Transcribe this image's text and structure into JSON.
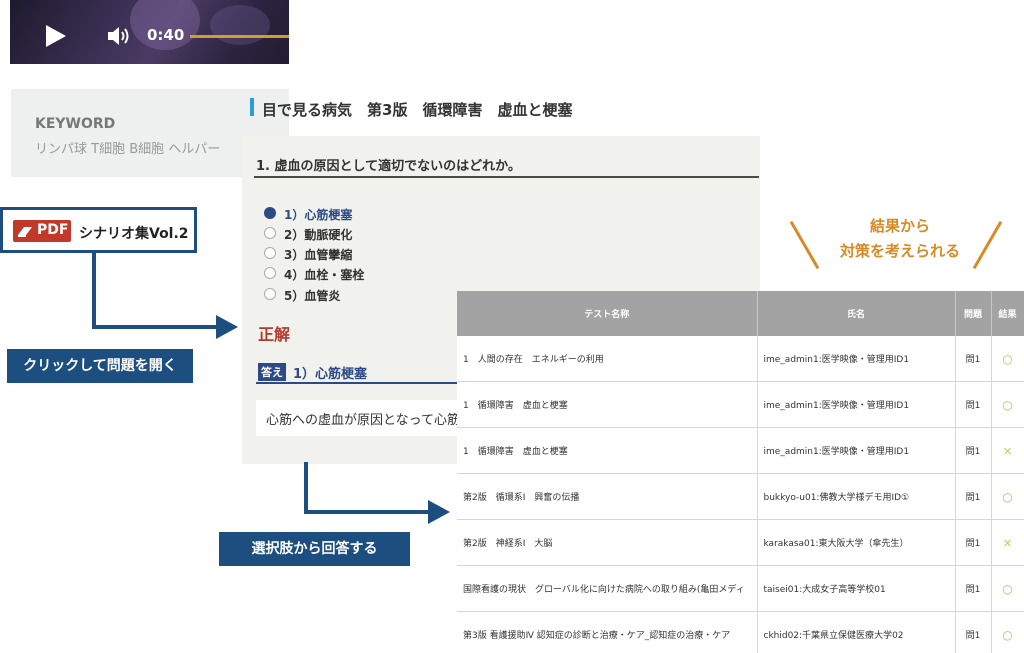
{
  "video": {
    "time": "0:40",
    "progress": 0.4
  },
  "keyword": {
    "label": "KEYWORD",
    "text": "リンパ球 T細胞 B細胞 ヘルパー"
  },
  "pdf_button": {
    "badge": "PDF",
    "title": "シナリオ集Vol.2"
  },
  "callouts": {
    "open_question": "クリックして問題を開く",
    "answer_choice": "選択肢から回答する"
  },
  "quiz": {
    "header": "目で見る病気　第3版　循環障害　虚血と梗塞",
    "question": "1. 虚血の原因として適切でないのはどれか。",
    "options": [
      "1）心筋梗塞",
      "2）動脈硬化",
      "3）血管攣縮",
      "4）血栓・塞栓",
      "5）血管炎"
    ],
    "selected_index": 0,
    "result_label": "正解",
    "answer_tag": "答え",
    "answer_text": "1）心筋梗塞",
    "explanation": "心筋への虚血が原因となって心筋"
  },
  "results_note": {
    "line1": "結果から",
    "line2": "対策を考えられる"
  },
  "results_table": {
    "headers": {
      "test_name": "テスト名称",
      "name": "氏名",
      "question": "問題",
      "result": "結果"
    },
    "rows": [
      {
        "test": "1　人間の存在　エネルギーの利用",
        "user": "ime_admin1:医学映像・管理用ID1",
        "q": "問1",
        "result": "○"
      },
      {
        "test": "1　循環障害　虚血と梗塞",
        "user": "ime_admin1:医学映像・管理用ID1",
        "q": "問1",
        "result": "○"
      },
      {
        "test": "1　循環障害　虚血と梗塞",
        "user": "ime_admin1:医学映像・管理用ID1",
        "q": "問1",
        "result": "×"
      },
      {
        "test": "第2版　循環系Ⅰ　興奮の伝播",
        "user": "bukkyo-u01:佛教大学様デモ用ID①",
        "q": "問1",
        "result": "○"
      },
      {
        "test": "第2版　神経系Ⅰ　大脳",
        "user": "karakasa01:東大阪大学（傘先生）",
        "q": "問1",
        "result": "×"
      },
      {
        "test": "国際看護の現状　グローバル化に向けた病院への取り組み(亀田メディ",
        "user": "taisei01:大成女子高等学校01",
        "q": "問1",
        "result": "○"
      },
      {
        "test": "第3版 看護援助Ⅳ 認知症の診断と治療・ケア_認知症の治療・ケア",
        "user": "ckhid02:千葉県立保健医療大学02",
        "q": "問1",
        "result": "○"
      }
    ]
  },
  "colors": {
    "navy": "#1c4f7f",
    "accent_blue": "#2e4a86",
    "orange": "#d88a24",
    "red": "#b23a2e",
    "pdf_red": "#c0392b"
  }
}
